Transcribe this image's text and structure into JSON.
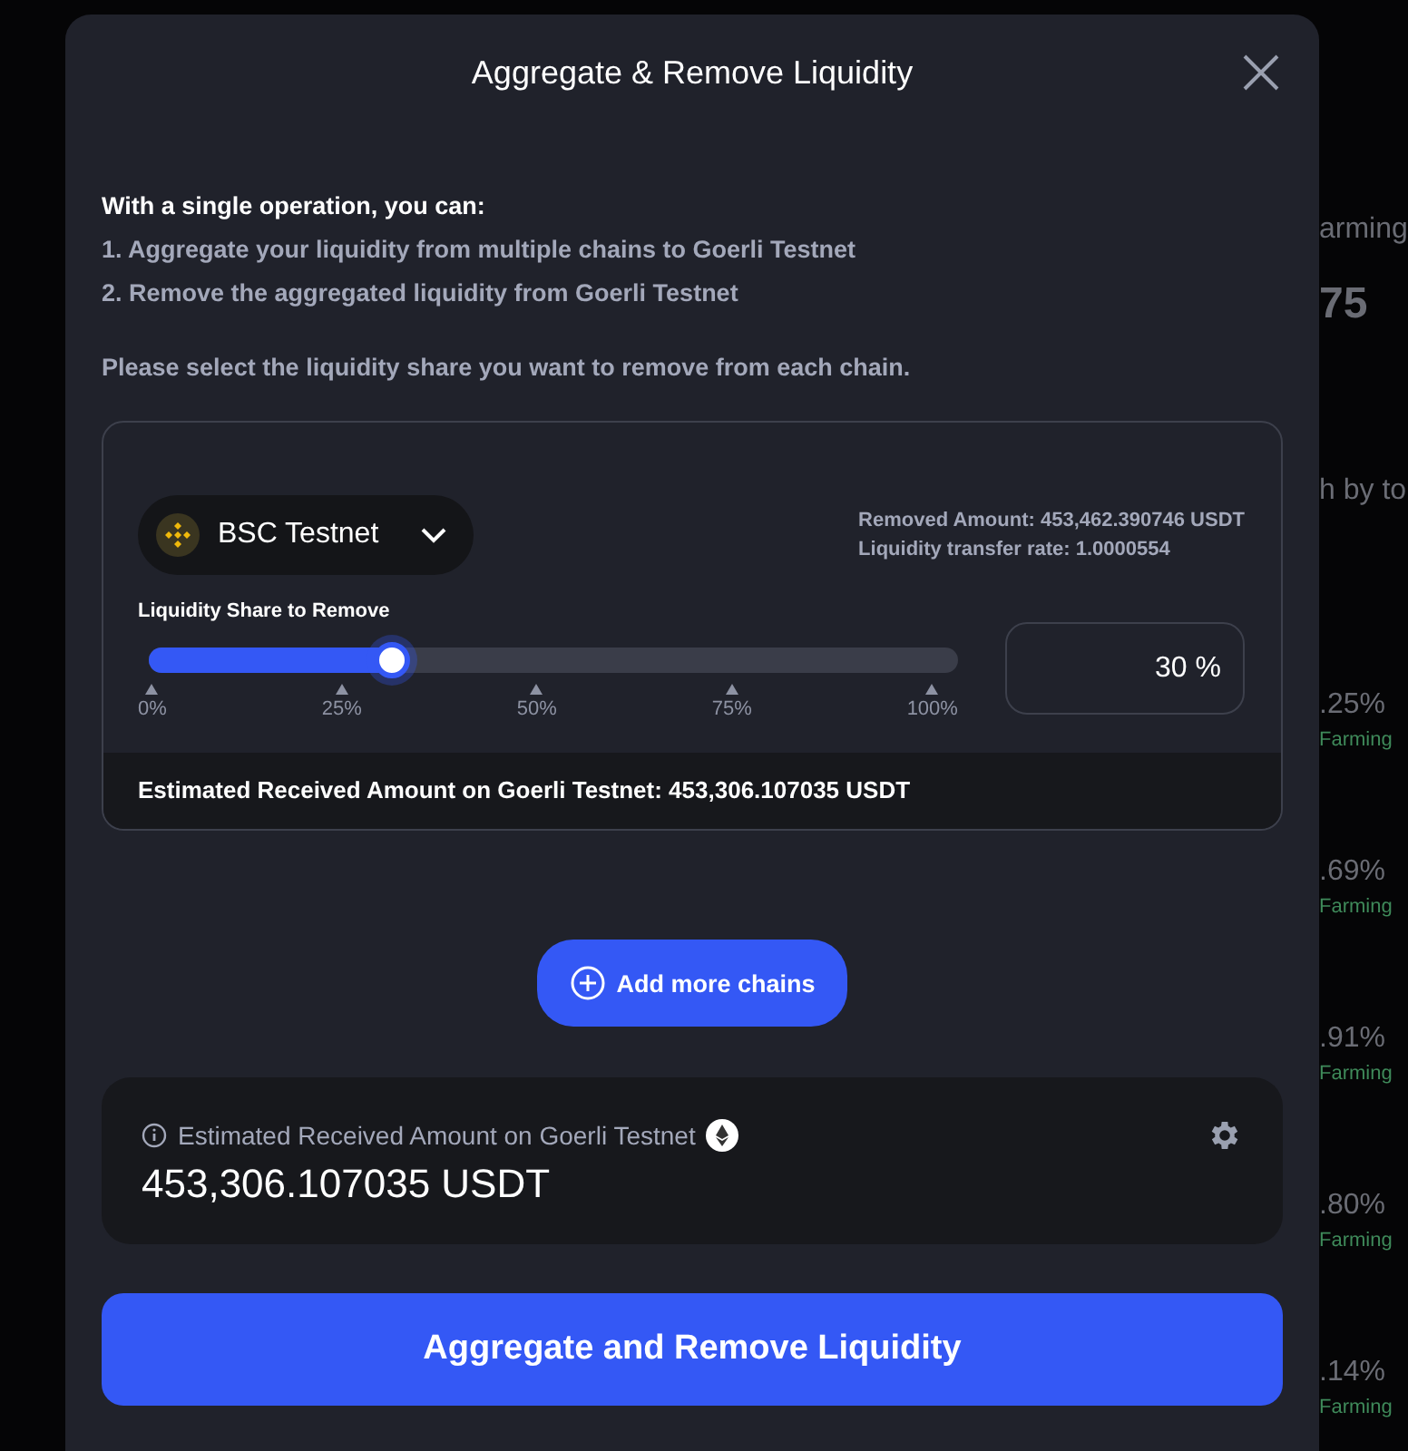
{
  "modal": {
    "title": "Aggregate & Remove Liquidity"
  },
  "intro": {
    "heading": "With a single operation, you can:",
    "steps": [
      "1. Aggregate your liquidity from multiple chains to Goerli Testnet",
      "2. Remove the aggregated liquidity from Goerli Testnet"
    ],
    "prompt": "Please select the liquidity share you want to remove from each chain."
  },
  "chains": [
    {
      "name": "BSC Testnet",
      "removed_amount": "Removed Amount: 453,462.390746 USDT",
      "transfer_rate": "Liquidity transfer rate: 1.0000554",
      "slider_label": "Liquidity Share to Remove",
      "level": 0.3,
      "ticks": [
        "0%",
        "25%",
        "50%",
        "75%",
        "100%"
      ],
      "percent": "30 %",
      "estimate": "Estimated Received Amount on Goerli Testnet: 453,306.107035 USDT"
    }
  ],
  "add_button": "Add more chains",
  "summary": {
    "label": "Estimated Received Amount on Goerli Testnet",
    "amount": "453,306.107035 USDT"
  },
  "submit_button": "Aggregate and Remove Liquidity",
  "background": {
    "right_texts": [
      {
        "kind": "label",
        "text": "arming"
      },
      {
        "kind": "big",
        "text": "75"
      },
      {
        "kind": "label",
        "text": "h by to"
      },
      {
        "kind": "value",
        "text": ".25%"
      },
      {
        "kind": "sub",
        "text": "Farming"
      },
      {
        "kind": "value",
        "text": ".69%"
      },
      {
        "kind": "sub",
        "text": "Farming"
      },
      {
        "kind": "value",
        "text": ".91%"
      },
      {
        "kind": "sub",
        "text": "Farming"
      },
      {
        "kind": "value",
        "text": ".80%"
      },
      {
        "kind": "sub",
        "text": "Farming"
      },
      {
        "kind": "value",
        "text": ".14%"
      },
      {
        "kind": "sub",
        "text": "Farming"
      }
    ]
  }
}
